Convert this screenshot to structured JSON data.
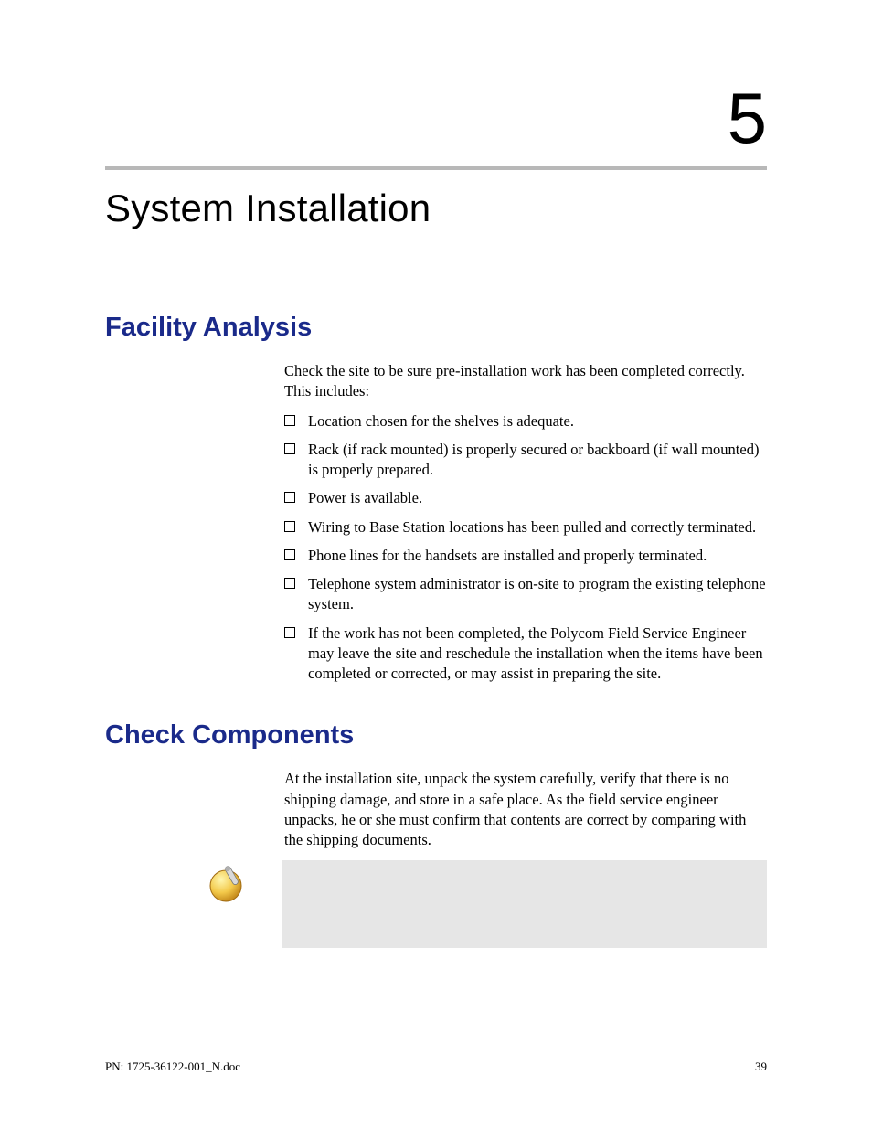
{
  "chapter": {
    "number": "5",
    "title": "System Installation"
  },
  "sections": [
    {
      "title": "Facility Analysis",
      "intro": "Check the site to be sure pre-installation work has been completed correctly. This includes:",
      "items": [
        "Location chosen for the shelves is adequate.",
        "Rack (if rack mounted) is properly secured or backboard (if wall mounted) is properly prepared.",
        "Power is available.",
        "Wiring to Base Station locations has been pulled and correctly terminated.",
        "Phone lines for the handsets are installed and properly terminated.",
        "Telephone system administrator is on-site to program the existing telephone system.",
        "If the work has not been completed, the Polycom Field Service Engineer may leave the site and reschedule the installation when the items have been completed or corrected, or may assist in preparing the site."
      ]
    },
    {
      "title": "Check Components",
      "intro": "At the installation site, unpack the system carefully, verify that there is no shipping damage, and store in a safe place. As the field service engineer unpacks, he or she must confirm that contents are correct by comparing with the shipping documents."
    }
  ],
  "footer": {
    "left": "PN: 1725-36122-001_N.doc",
    "right": "39"
  },
  "colors": {
    "heading": "#1a2a8a",
    "rule": "#b8b8b8",
    "notebg": "#e6e6e6"
  }
}
